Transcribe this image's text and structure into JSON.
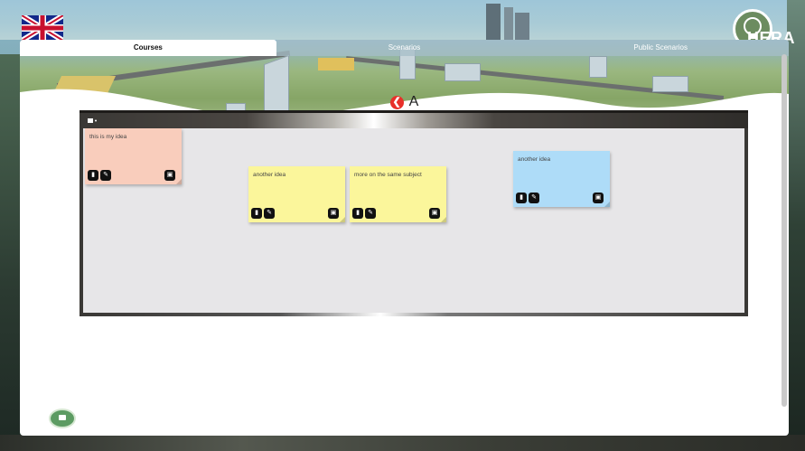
{
  "language": {
    "flag": "uk-flag-icon"
  },
  "brand": {
    "logo_text": "HERA",
    "logo_icon": "lightbulb-gear-icon"
  },
  "tabs": [
    {
      "label": "Courses",
      "active": true
    },
    {
      "label": "Scenarios",
      "active": false
    },
    {
      "label": "Public Scenarios",
      "active": false
    }
  ],
  "header": {
    "back_icon": "arrow-left-circle-icon",
    "title": "A"
  },
  "board": {
    "toolbar_icon": "add-note-icon",
    "notes": [
      {
        "text": "this is my idea",
        "color": "#f9cdbc"
      },
      {
        "text": "another idea",
        "color": "#fbf69b"
      },
      {
        "text": "more on the same subject",
        "color": "#fbf69b"
      },
      {
        "text": "another idea",
        "color": "#aedcf8"
      }
    ]
  },
  "chat": {
    "icon": "chat-bubble-icon"
  },
  "colors": {
    "accent_red": "#e8302a",
    "chat_green": "#5c9b62"
  }
}
